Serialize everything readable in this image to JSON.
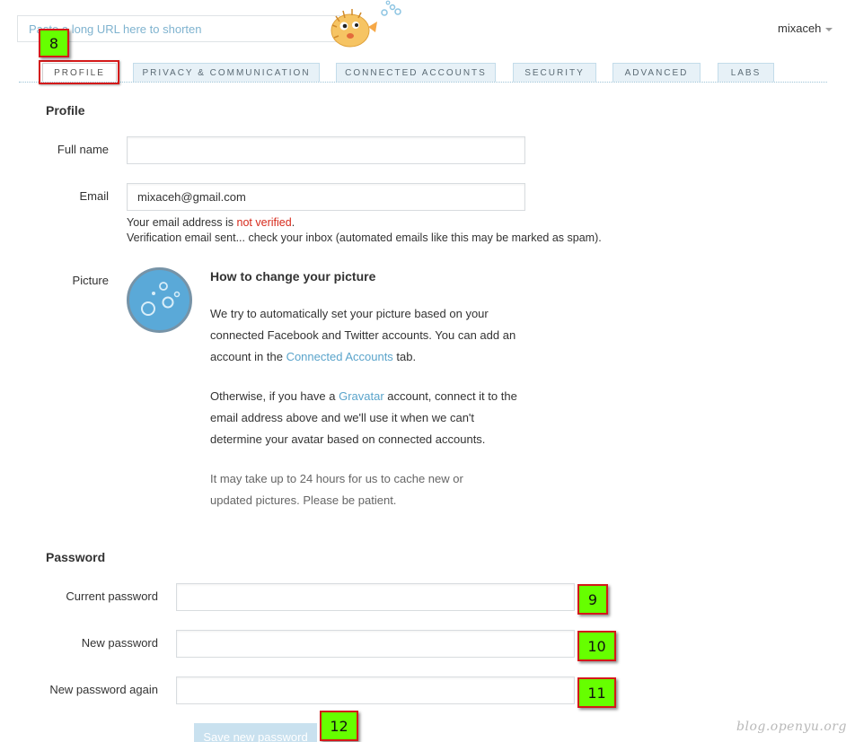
{
  "header": {
    "shorten_placeholder": "Paste a long URL here to shorten",
    "username": "mixaceh"
  },
  "tabs": [
    {
      "label": "Profile"
    },
    {
      "label": "Privacy & Communication"
    },
    {
      "label": "Connected Accounts"
    },
    {
      "label": "Security"
    },
    {
      "label": "Advanced"
    },
    {
      "label": "Labs"
    }
  ],
  "profile": {
    "title": "Profile",
    "full_name_label": "Full name",
    "full_name_value": "",
    "email_label": "Email",
    "email_value": "mixaceh@gmail.com",
    "email_status_prefix": "Your email address is ",
    "email_status_flag": "not verified",
    "email_status_suffix": ".",
    "verification_note": "Verification email sent... check your inbox (automated emails like this may be marked as spam).",
    "picture_label": "Picture",
    "help": {
      "title": "How to change your picture",
      "p1_before": "We try to automatically set your picture based on your connected Facebook and Twitter accounts. You can add an account in the ",
      "p1_link": "Connected Accounts",
      "p1_after": " tab.",
      "p2_before": "Otherwise, if you have a ",
      "p2_link": "Gravatar",
      "p2_after": " account, connect it to the email address above and we'll use it when we can't determine your avatar based on connected accounts.",
      "p3": "It may take up to 24 hours for us to cache new or updated pictures. Please be patient."
    }
  },
  "password": {
    "title": "Password",
    "current_label": "Current password",
    "new_label": "New password",
    "again_label": "New password again",
    "save_label": "Save new password"
  },
  "annotations": {
    "n8": "8",
    "n9": "9",
    "n10": "10",
    "n11": "11",
    "n12": "12"
  },
  "watermark": "blog.openyu.org",
  "colors": {
    "accent_link": "#5aa4cb",
    "error_red": "#d6291b",
    "annotation_green": "#66ff00",
    "annotation_border": "#d41919"
  }
}
